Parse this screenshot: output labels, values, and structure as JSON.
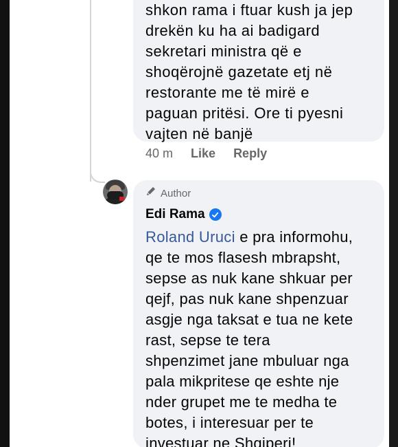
{
  "comment1": {
    "text": "shkon rama  i ftuar kush ja jep\ndrekën ku ha ai badigard\nsekretari ministra që e\nshoqërojnë gazetate etj në\nrestorante me të mirë e\npaguan pritësi. Ore ti pyesni\nvajten në banjë",
    "time": "40 m",
    "like_label": "Like",
    "reply_label": "Reply"
  },
  "reply": {
    "badge": "Author",
    "author_name": "Edi Rama",
    "mention": "Roland Uruci",
    "text_after_mention": " e pra informohu,\nqe te mos flasesh mbrapsht,\nsepse as nuk kane shkuar per\nqejf, pas nuk kane shpenzuar\nasgje nga taksat e tua ne kete\nrast, sepse te tera\nshpenzimet jane mbuluar nga\npala mikpritese qe eshte nje\nnder grupet me te medha te\nbotes, i  interesuar per te\ninvestuar ne Shqiperi!"
  },
  "icons": {
    "author_badge_icon": "pencil-icon",
    "verified_icon": "verified-badge-icon"
  },
  "colors": {
    "bubble": "#f0f2f5",
    "mention": "#385898",
    "verified": "#1877f2",
    "muted": "#65676b"
  }
}
